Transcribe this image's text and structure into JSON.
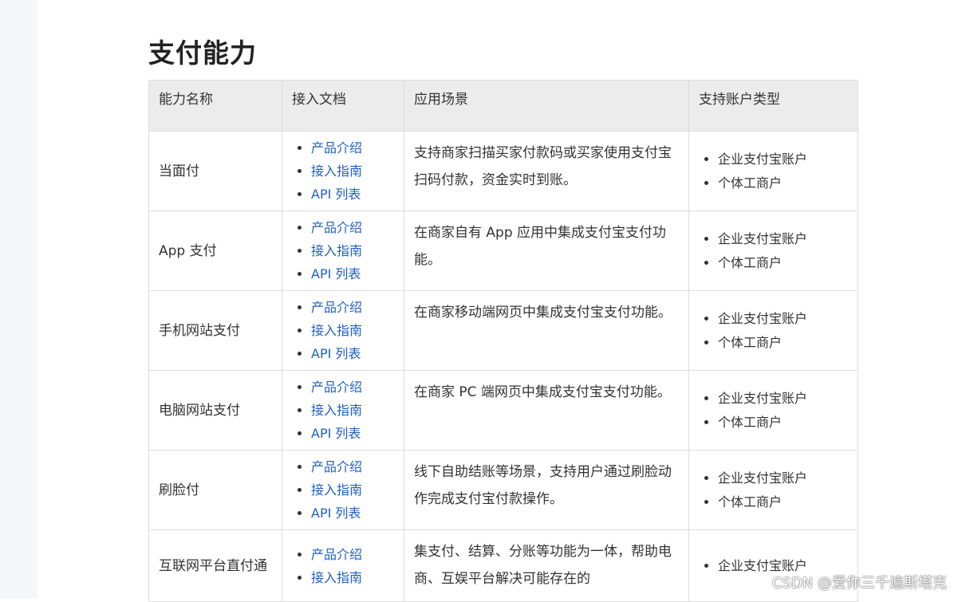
{
  "page_title": "支付能力",
  "columns": [
    "能力名称",
    "接入文档",
    "应用场景",
    "支持账户类型"
  ],
  "rows": [
    {
      "name": "当面付",
      "docs": [
        "产品介绍",
        "接入指南",
        "API 列表"
      ],
      "scene": "支持商家扫描买家付款码或买家使用支付宝扫码付款，资金实时到账。",
      "accounts": [
        "企业支付宝账户",
        "个体工商户"
      ]
    },
    {
      "name": "App 支付",
      "docs": [
        "产品介绍",
        "接入指南",
        "API 列表"
      ],
      "scene": "在商家自有 App 应用中集成支付宝支付功能。",
      "accounts": [
        "企业支付宝账户",
        "个体工商户"
      ]
    },
    {
      "name": "手机网站支付",
      "docs": [
        "产品介绍",
        "接入指南",
        "API 列表"
      ],
      "scene": "在商家移动端网页中集成支付宝支付功能。",
      "accounts": [
        "企业支付宝账户",
        "个体工商户"
      ]
    },
    {
      "name": "电脑网站支付",
      "docs": [
        "产品介绍",
        "接入指南",
        "API 列表"
      ],
      "scene": "在商家 PC 端网页中集成支付宝支付功能。",
      "accounts": [
        "企业支付宝账户",
        "个体工商户"
      ]
    },
    {
      "name": "刷脸付",
      "docs": [
        "产品介绍",
        "接入指南",
        "API 列表"
      ],
      "scene": "线下自助结账等场景，支持用户通过刷脸动作完成支付宝付款操作。",
      "accounts": [
        "企业支付宝账户",
        "个体工商户"
      ]
    },
    {
      "name": "互联网平台直付通",
      "docs": [
        "产品介绍",
        "接入指南"
      ],
      "scene": "集支付、结算、分账等功能为一体，帮助电商、互娱平台解决可能存在的",
      "accounts": [
        "企业支付宝账户"
      ]
    }
  ],
  "watermark": "CSDN @爱你三千遍斯塔克",
  "colors": {
    "link": "#1f5fbf",
    "header_bg": "#ececec",
    "border": "#dddddd"
  }
}
